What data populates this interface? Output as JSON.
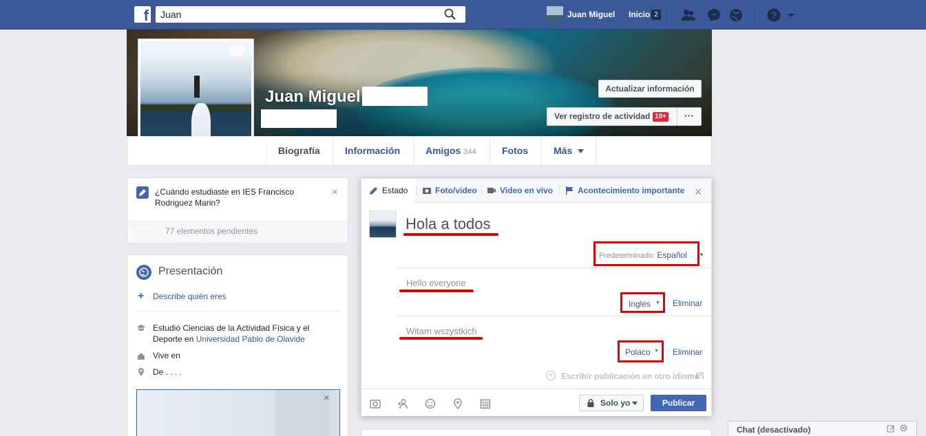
{
  "topbar": {
    "logo": "f",
    "search_value": "Juan",
    "user_name": "Juan Miguel",
    "home_label": "Inicio",
    "home_count": "2"
  },
  "profile": {
    "name": "Juan Miguel",
    "update_info": "Actualizar información",
    "activity_log": "Ver registro de actividad",
    "activity_badge": "10+",
    "more": "···"
  },
  "nav": {
    "tabs": [
      {
        "label": "Biografía",
        "active": true
      },
      {
        "label": "Información"
      },
      {
        "label": "Amigos",
        "count": "344"
      },
      {
        "label": "Fotos"
      },
      {
        "label": "Más"
      }
    ]
  },
  "question": {
    "text": "¿Cuándo estudiaste en IES Francisco Rodriguez Marin?",
    "close": "×",
    "dots": "···",
    "pending": "77 elementos pendientes"
  },
  "intro": {
    "title": "Presentación",
    "describe": "Describe quién eres",
    "studied_prefix": "Estudió Ciencias de la Actividad Física y el Deporte en",
    "studied_uni": "Universidad Pablo de Olavide",
    "lives": "Vive en",
    "from": "De . . . .",
    "map_close": "×"
  },
  "composer": {
    "tabs": [
      {
        "label": "Estado",
        "icon": "pencil-icon"
      },
      {
        "label": "Foto/video",
        "icon": "camera-icon"
      },
      {
        "label": "Video en vivo",
        "icon": "video-camera-icon"
      },
      {
        "label": "Acontecimiento importante",
        "icon": "flag-icon"
      }
    ],
    "close": "×",
    "text": "Hola a todos",
    "default_label": "Predeterminado:",
    "default_lang": "Español",
    "translation1": "Hello everyone",
    "lang1": "Inglés",
    "delete": "Eliminar",
    "translation2": "Witam wszystkich",
    "lang2": "Polaco",
    "other_lang": "Escribir publicación en otro idioma",
    "help": "[?]",
    "privacy": "Solo yo",
    "publish": "Publicar"
  },
  "chat": {
    "label": "Chat (desactivado)"
  },
  "colors": {
    "brand": "#3b5998",
    "link": "#365899",
    "button": "#4267b2",
    "highlight": "#e00000"
  }
}
